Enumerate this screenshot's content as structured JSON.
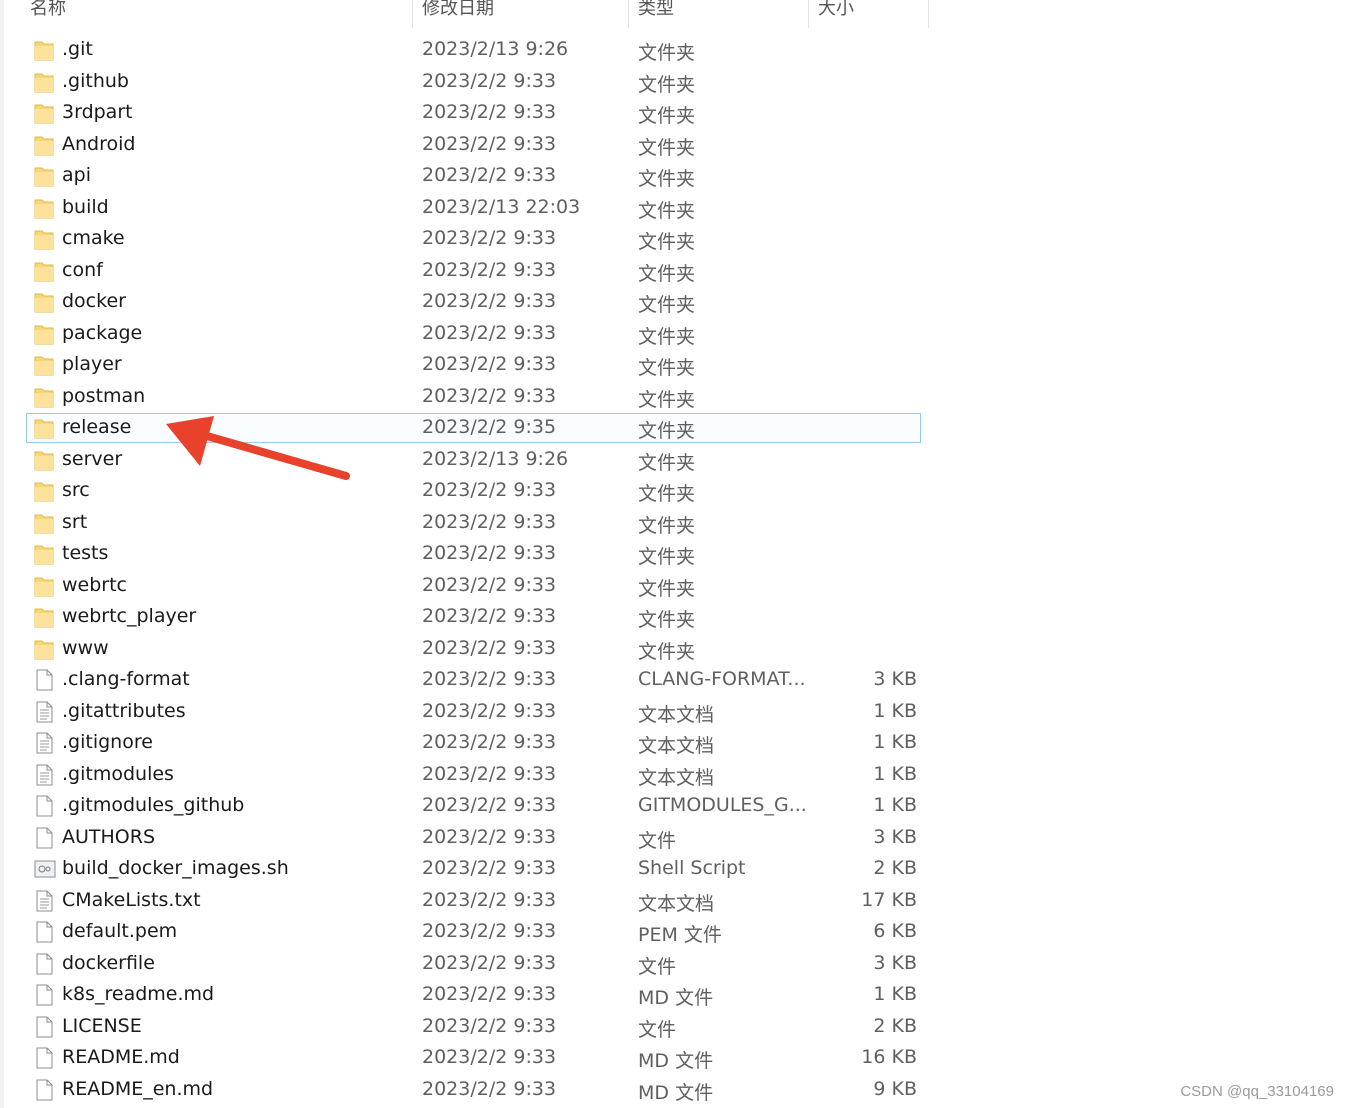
{
  "header": {
    "name": "名称",
    "date": "修改日期",
    "type": "类型",
    "size": "大小"
  },
  "selected_index": 12,
  "files": [
    {
      "name": ".git",
      "date": "2023/2/13 9:26",
      "type": "文件夹",
      "size": "",
      "icon": "folder-icon"
    },
    {
      "name": ".github",
      "date": "2023/2/2 9:33",
      "type": "文件夹",
      "size": "",
      "icon": "folder-icon"
    },
    {
      "name": "3rdpart",
      "date": "2023/2/2 9:33",
      "type": "文件夹",
      "size": "",
      "icon": "folder-icon"
    },
    {
      "name": "Android",
      "date": "2023/2/2 9:33",
      "type": "文件夹",
      "size": "",
      "icon": "folder-icon"
    },
    {
      "name": "api",
      "date": "2023/2/2 9:33",
      "type": "文件夹",
      "size": "",
      "icon": "folder-icon"
    },
    {
      "name": "build",
      "date": "2023/2/13 22:03",
      "type": "文件夹",
      "size": "",
      "icon": "folder-icon"
    },
    {
      "name": "cmake",
      "date": "2023/2/2 9:33",
      "type": "文件夹",
      "size": "",
      "icon": "folder-icon"
    },
    {
      "name": "conf",
      "date": "2023/2/2 9:33",
      "type": "文件夹",
      "size": "",
      "icon": "folder-icon"
    },
    {
      "name": "docker",
      "date": "2023/2/2 9:33",
      "type": "文件夹",
      "size": "",
      "icon": "folder-icon"
    },
    {
      "name": "package",
      "date": "2023/2/2 9:33",
      "type": "文件夹",
      "size": "",
      "icon": "folder-icon"
    },
    {
      "name": "player",
      "date": "2023/2/2 9:33",
      "type": "文件夹",
      "size": "",
      "icon": "folder-icon"
    },
    {
      "name": "postman",
      "date": "2023/2/2 9:33",
      "type": "文件夹",
      "size": "",
      "icon": "folder-icon"
    },
    {
      "name": "release",
      "date": "2023/2/2 9:35",
      "type": "文件夹",
      "size": "",
      "icon": "folder-icon"
    },
    {
      "name": "server",
      "date": "2023/2/13 9:26",
      "type": "文件夹",
      "size": "",
      "icon": "folder-icon"
    },
    {
      "name": "src",
      "date": "2023/2/2 9:33",
      "type": "文件夹",
      "size": "",
      "icon": "folder-icon"
    },
    {
      "name": "srt",
      "date": "2023/2/2 9:33",
      "type": "文件夹",
      "size": "",
      "icon": "folder-icon"
    },
    {
      "name": "tests",
      "date": "2023/2/2 9:33",
      "type": "文件夹",
      "size": "",
      "icon": "folder-icon"
    },
    {
      "name": "webrtc",
      "date": "2023/2/2 9:33",
      "type": "文件夹",
      "size": "",
      "icon": "folder-icon"
    },
    {
      "name": "webrtc_player",
      "date": "2023/2/2 9:33",
      "type": "文件夹",
      "size": "",
      "icon": "folder-icon"
    },
    {
      "name": "www",
      "date": "2023/2/2 9:33",
      "type": "文件夹",
      "size": "",
      "icon": "folder-icon"
    },
    {
      "name": ".clang-format",
      "date": "2023/2/2 9:33",
      "type": "CLANG-FORMAT...",
      "size": "3 KB",
      "icon": "file-icon"
    },
    {
      "name": ".gitattributes",
      "date": "2023/2/2 9:33",
      "type": "文本文档",
      "size": "1 KB",
      "icon": "text-file-icon"
    },
    {
      "name": ".gitignore",
      "date": "2023/2/2 9:33",
      "type": "文本文档",
      "size": "1 KB",
      "icon": "text-file-icon"
    },
    {
      "name": ".gitmodules",
      "date": "2023/2/2 9:33",
      "type": "文本文档",
      "size": "1 KB",
      "icon": "text-file-icon"
    },
    {
      "name": ".gitmodules_github",
      "date": "2023/2/2 9:33",
      "type": "GITMODULES_G...",
      "size": "1 KB",
      "icon": "file-icon"
    },
    {
      "name": "AUTHORS",
      "date": "2023/2/2 9:33",
      "type": "文件",
      "size": "3 KB",
      "icon": "file-icon"
    },
    {
      "name": "build_docker_images.sh",
      "date": "2023/2/2 9:33",
      "type": "Shell Script",
      "size": "2 KB",
      "icon": "script-file-icon"
    },
    {
      "name": "CMakeLists.txt",
      "date": "2023/2/2 9:33",
      "type": "文本文档",
      "size": "17 KB",
      "icon": "text-file-icon"
    },
    {
      "name": "default.pem",
      "date": "2023/2/2 9:33",
      "type": "PEM 文件",
      "size": "6 KB",
      "icon": "file-icon"
    },
    {
      "name": "dockerfile",
      "date": "2023/2/2 9:33",
      "type": "文件",
      "size": "3 KB",
      "icon": "file-icon"
    },
    {
      "name": "k8s_readme.md",
      "date": "2023/2/2 9:33",
      "type": "MD 文件",
      "size": "1 KB",
      "icon": "file-icon"
    },
    {
      "name": "LICENSE",
      "date": "2023/2/2 9:33",
      "type": "文件",
      "size": "2 KB",
      "icon": "file-icon"
    },
    {
      "name": "README.md",
      "date": "2023/2/2 9:33",
      "type": "MD 文件",
      "size": "16 KB",
      "icon": "file-icon"
    },
    {
      "name": "README_en.md",
      "date": "2023/2/2 9:33",
      "type": "MD 文件",
      "size": "9 KB",
      "icon": "file-icon"
    }
  ],
  "watermark": "CSDN @qq_33104169",
  "colors": {
    "selection_border": "#99c9ef",
    "arrow": "#e8412c",
    "folder": "#f8d775"
  }
}
